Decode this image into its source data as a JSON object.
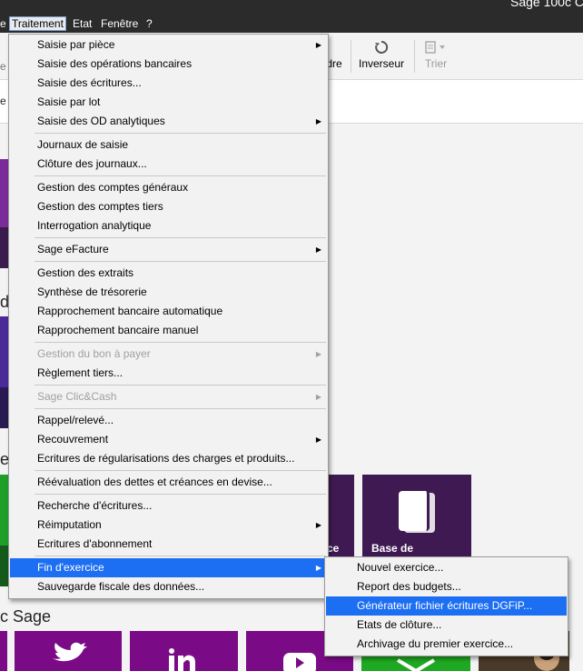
{
  "window": {
    "title": "Sage 100c C"
  },
  "menubar": {
    "items": [
      {
        "label": "e"
      },
      {
        "label": "Traitement"
      },
      {
        "label": "Etat"
      },
      {
        "label": "Fenêtre"
      },
      {
        "label": "?"
      }
    ]
  },
  "toolbar": {
    "left_fragment": "e",
    "partial_label": "dre",
    "inverseur_label": "Inverseur",
    "trier_label": "Trier"
  },
  "background": {
    "section_d": "d",
    "section_e": "e",
    "sage_heading": "c Sage",
    "tile_partial_label": "ce",
    "tile_base_label": "Base de"
  },
  "traitement_menu": {
    "items": [
      {
        "label": "Saisie par pièce",
        "submenu": true,
        "disabled": false
      },
      {
        "label": "Saisie des opérations bancaires",
        "submenu": false,
        "disabled": false
      },
      {
        "label": "Saisie des écritures...",
        "submenu": false,
        "disabled": false
      },
      {
        "label": "Saisie par lot",
        "submenu": false,
        "disabled": false
      },
      {
        "label": "Saisie des OD analytiques",
        "submenu": true,
        "disabled": false
      },
      {
        "label": "Journaux de saisie",
        "submenu": false,
        "disabled": false
      },
      {
        "label": "Clôture des journaux...",
        "submenu": false,
        "disabled": false
      },
      {
        "label": "Gestion des comptes généraux",
        "submenu": false,
        "disabled": false
      },
      {
        "label": "Gestion des comptes tiers",
        "submenu": false,
        "disabled": false
      },
      {
        "label": "Interrogation analytique",
        "submenu": false,
        "disabled": false
      },
      {
        "label": "Sage eFacture",
        "submenu": true,
        "disabled": false
      },
      {
        "label": "Gestion des extraits",
        "submenu": false,
        "disabled": false
      },
      {
        "label": "Synthèse de trésorerie",
        "submenu": false,
        "disabled": false
      },
      {
        "label": "Rapprochement bancaire automatique",
        "submenu": false,
        "disabled": false
      },
      {
        "label": "Rapprochement bancaire manuel",
        "submenu": false,
        "disabled": false
      },
      {
        "label": "Gestion du bon à payer",
        "submenu": true,
        "disabled": true
      },
      {
        "label": "Règlement tiers...",
        "submenu": false,
        "disabled": false
      },
      {
        "label": "Sage Clic&Cash",
        "submenu": true,
        "disabled": true
      },
      {
        "label": "Rappel/relevé...",
        "submenu": false,
        "disabled": false
      },
      {
        "label": "Recouvrement",
        "submenu": true,
        "disabled": false
      },
      {
        "label": "Ecritures de régularisations des charges et produits...",
        "submenu": false,
        "disabled": false
      },
      {
        "label": "Réévaluation des dettes et créances en devise...",
        "submenu": false,
        "disabled": false
      },
      {
        "label": "Recherche d'écritures...",
        "submenu": false,
        "disabled": false
      },
      {
        "label": "Réimputation",
        "submenu": true,
        "disabled": false
      },
      {
        "label": "Ecritures d'abonnement",
        "submenu": false,
        "disabled": false
      },
      {
        "label": "Fin d'exercice",
        "submenu": true,
        "disabled": false,
        "highlighted": true
      },
      {
        "label": "Sauvegarde fiscale des données...",
        "submenu": false,
        "disabled": false
      }
    ]
  },
  "fin_exercice_submenu": {
    "items": [
      {
        "label": "Nouvel exercice..."
      },
      {
        "label": "Report des budgets..."
      },
      {
        "label": "Générateur fichier écritures DGFiP...",
        "selected": true
      },
      {
        "label": "Etats de clôture..."
      },
      {
        "label": "Archivage du premier exercice..."
      }
    ]
  },
  "colors": {
    "menu_highlight": "#1c6ef2",
    "tile_purple": "#3f1a52",
    "social_purple": "#7b0a86"
  }
}
